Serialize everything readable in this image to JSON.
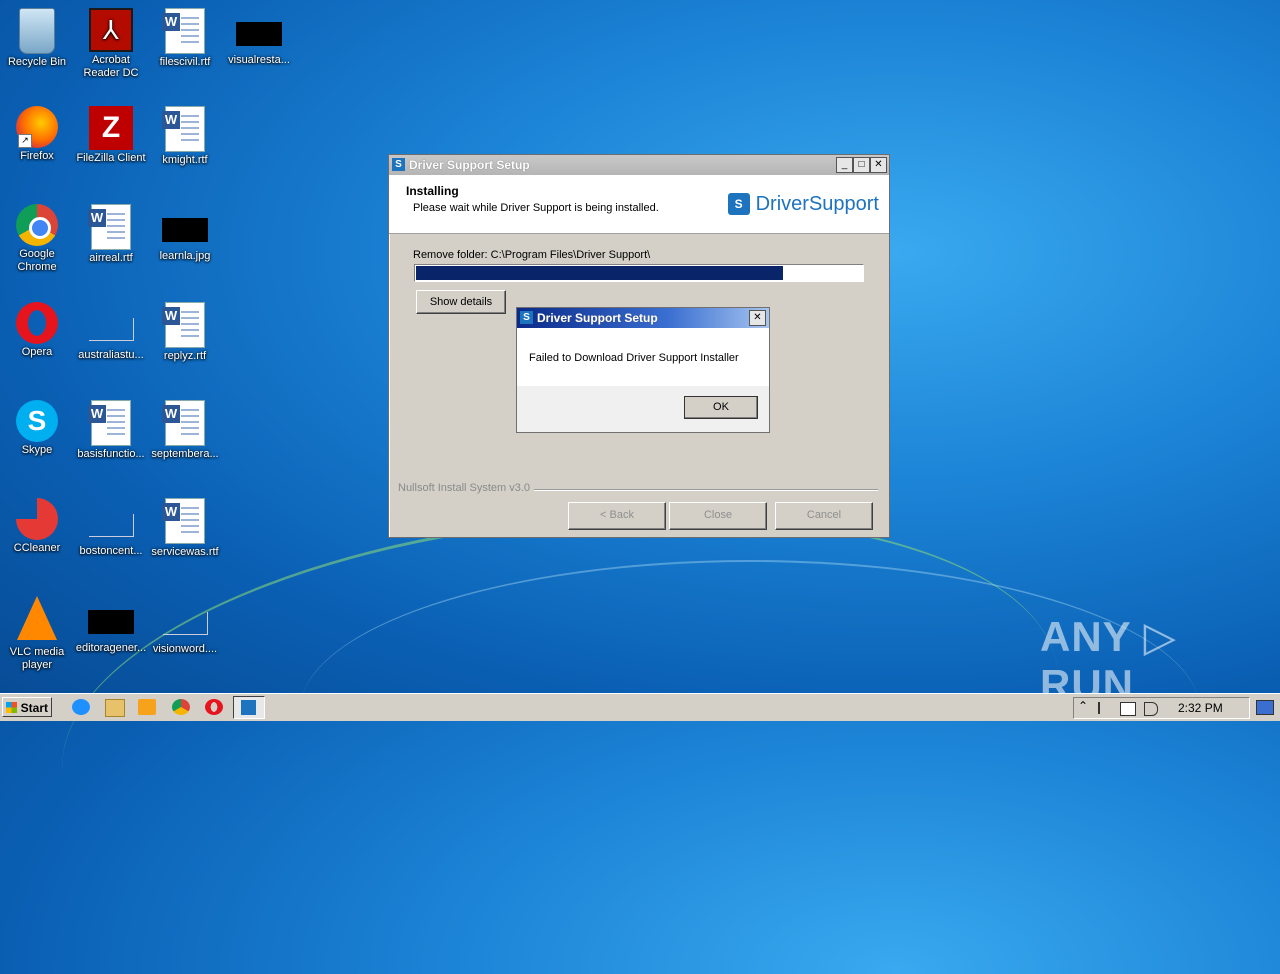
{
  "desktop": {
    "icons": [
      {
        "label": "Recycle Bin"
      },
      {
        "label": "Acrobat Reader DC"
      },
      {
        "label": "filescivil.rtf"
      },
      {
        "label": "visualresta..."
      },
      {
        "label": "Firefox"
      },
      {
        "label": "FileZilla Client"
      },
      {
        "label": "kmight.rtf"
      },
      {
        "label": "Google Chrome"
      },
      {
        "label": "airreal.rtf"
      },
      {
        "label": "learnla.jpg"
      },
      {
        "label": "Opera"
      },
      {
        "label": "australiastu..."
      },
      {
        "label": "replyz.rtf"
      },
      {
        "label": "Skype"
      },
      {
        "label": "basisfunctio..."
      },
      {
        "label": "septembera..."
      },
      {
        "label": "CCleaner"
      },
      {
        "label": "bostoncent..."
      },
      {
        "label": "servicewas.rtf"
      },
      {
        "label": "VLC media player"
      },
      {
        "label": "editoragener..."
      },
      {
        "label": "visionword...."
      }
    ],
    "glyphs": {
      "acrobat": "⅄",
      "word": "W",
      "filezilla": "Z",
      "skype": "S",
      "shortcut": "↗"
    }
  },
  "installer": {
    "title": "Driver Support Setup",
    "header_title": "Installing",
    "header_subtitle": "Please wait while Driver Support is being installed.",
    "logo_text": "DriverSupport",
    "status_text": "Remove folder: C:\\Program Files\\Driver Support\\",
    "progress_fraction": 0.82,
    "show_details_label": "Show details",
    "branding": "Nullsoft Install System v3.0",
    "back_label": "< Back",
    "close_label": "Close",
    "cancel_label": "Cancel",
    "min_glyph": "_",
    "max_glyph": "□",
    "close_glyph": "✕"
  },
  "message_box": {
    "title": "Driver Support Setup",
    "message": "Failed to Download Driver Support Installer",
    "ok_label": "OK",
    "close_glyph": "✕"
  },
  "taskbar": {
    "start_label": "Start",
    "clock": "2:32 PM",
    "tray_up_glyph": "⌃"
  },
  "watermark": "ANY ▷ RUN",
  "colors": {
    "progress": "#0a246a",
    "accent": "#1e73be"
  }
}
